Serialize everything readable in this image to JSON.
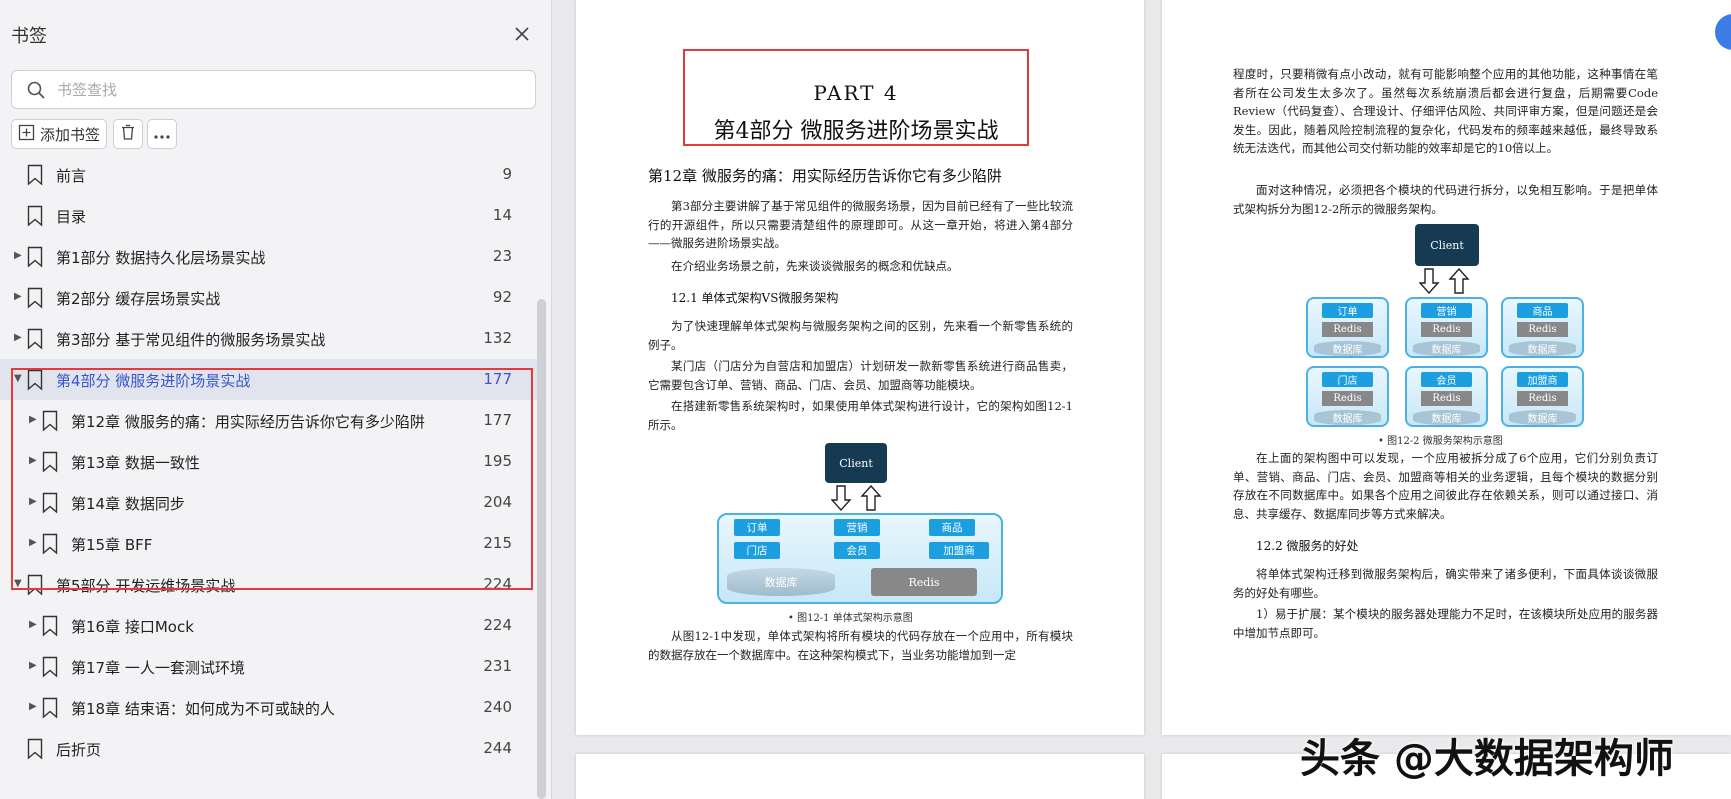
{
  "sidebar": {
    "title": "书签",
    "search_placeholder": "书签查找",
    "add_label": "添加书签",
    "items": [
      {
        "label": "前言",
        "page": "9",
        "level": 0,
        "expander": "none"
      },
      {
        "label": "目录",
        "page": "14",
        "level": 0,
        "expander": "none"
      },
      {
        "label": "第1部分 数据持久化层场景实战",
        "page": "23",
        "level": 0,
        "expander": "collapsed"
      },
      {
        "label": "第2部分 缓存层场景实战",
        "page": "92",
        "level": 0,
        "expander": "collapsed"
      },
      {
        "label": "第3部分 基于常见组件的微服务场景实战",
        "page": "132",
        "level": 0,
        "expander": "collapsed"
      },
      {
        "label": "第4部分 微服务进阶场景实战",
        "page": "177",
        "level": 0,
        "expander": "expanded",
        "active": true
      },
      {
        "label": "第12章 微服务的痛：用实际经历告诉你它有多少陷阱",
        "page": "177",
        "level": 1,
        "expander": "collapsed"
      },
      {
        "label": "第13章 数据一致性",
        "page": "195",
        "level": 1,
        "expander": "collapsed"
      },
      {
        "label": "第14章 数据同步",
        "page": "204",
        "level": 1,
        "expander": "collapsed"
      },
      {
        "label": "第15章 BFF",
        "page": "215",
        "level": 1,
        "expander": "collapsed"
      },
      {
        "label": "第5部分 开发运维场景实战",
        "page": "224",
        "level": 0,
        "expander": "expanded"
      },
      {
        "label": "第16章 接口Mock",
        "page": "224",
        "level": 1,
        "expander": "collapsed"
      },
      {
        "label": "第17章 一人一套测试环境",
        "page": "231",
        "level": 1,
        "expander": "collapsed"
      },
      {
        "label": "第18章 结束语：如何成为不可或缺的人",
        "page": "240",
        "level": 1,
        "expander": "collapsed"
      },
      {
        "label": "后折页",
        "page": "244",
        "level": 0,
        "expander": "none"
      }
    ]
  },
  "left_page": {
    "part_en": "PART 4",
    "part_cn": "第4部分  微服务进阶场景实战",
    "chapter_title": "第12章  微服务的痛：用实际经历告诉你它有多少陷阱",
    "p1": "第3部分主要讲解了基于常见组件的微服务场景，因为目前已经有了一些比较流行的开源组件，所以只需要清楚组件的原理即可。从这一章开始，将进入第4部分——微服务进阶场景实战。",
    "p2": "在介绍业务场景之前，先来谈谈微服务的概念和优缺点。",
    "section": "12.1  单体式架构VS微服务架构",
    "p3": "为了快速理解单体式架构与微服务架构之间的区别，先来看一个新零售系统的例子。",
    "p4": "某门店（门店分为自营店和加盟店）计划研发一款新零售系统进行商品售卖，它需要包含订单、营销、商品、门店、会员、加盟商等功能模块。",
    "p5": "在搭建新零售系统架构时，如果使用单体式架构进行设计，它的架构如图12-1所示。",
    "diagram": {
      "client": "Client",
      "modules": [
        "订单",
        "营销",
        "商品",
        "门店",
        "会员",
        "加盟商"
      ],
      "db": "数据库",
      "redis": "Redis"
    },
    "caption": "• 图12-1  单体式架构示意图",
    "p6": "从图12-1中发现，单体式架构将所有模块的代码存放在一个应用中，所有模块的数据存放在一个数据库中。在这种架构模式下，当业务功能增加到一定"
  },
  "right_page": {
    "p1": "程度时，只要稍微有点小改动，就有可能影响整个应用的其他功能，这种事情在笔者所在公司发生太多次了。虽然每次系统崩溃后都会进行复盘，后期需要Code Review（代码复查）、合理设计、仔细评估风险、共同评审方案，但是问题还是会发生。因此，随着风险控制流程的复杂化，代码发布的频率越来越低，最终导致系统无法迭代，而其他公司交付新功能的效率却是它的10倍以上。",
    "p2": "面对这种情况，必须把各个模块的代码进行拆分，以免相互影响。于是把单体式架构拆分为图12-2所示的微服务架构。",
    "diagram": {
      "client": "Client",
      "services": [
        "订单",
        "营销",
        "商品",
        "门店",
        "会员",
        "加盟商"
      ],
      "redis": "Redis",
      "db": "数据库"
    },
    "caption": "• 图12-2  微服务架构示意图",
    "p3": "在上面的架构图中可以发现，一个应用被拆分成了6个应用，它们分别负责订单、营销、商品、门店、会员、加盟商等相关的业务逻辑，且每个模块的数据分别存放在不同数据库中。如果各个应用之间彼此存在依赖关系，则可以通过接口、消息、共享缓存、数据库同步等方式来解决。",
    "section": "12.2  微服务的好处",
    "p4": "将单体式架构迁移到微服务架构后，确实带来了诸多便利，下面具体谈谈微服务的好处有哪些。",
    "p5": "1）易于扩展：某个模块的服务器处理能力不足时，在该模块所处应用的服务器中增加节点即可。"
  },
  "watermark": "头条 @大数据架构师",
  "colors": {
    "highlight": "#e23b3b",
    "active_text": "#3856c9",
    "diagram_blue": "#1c9fe0",
    "client_bg": "#163a52"
  }
}
